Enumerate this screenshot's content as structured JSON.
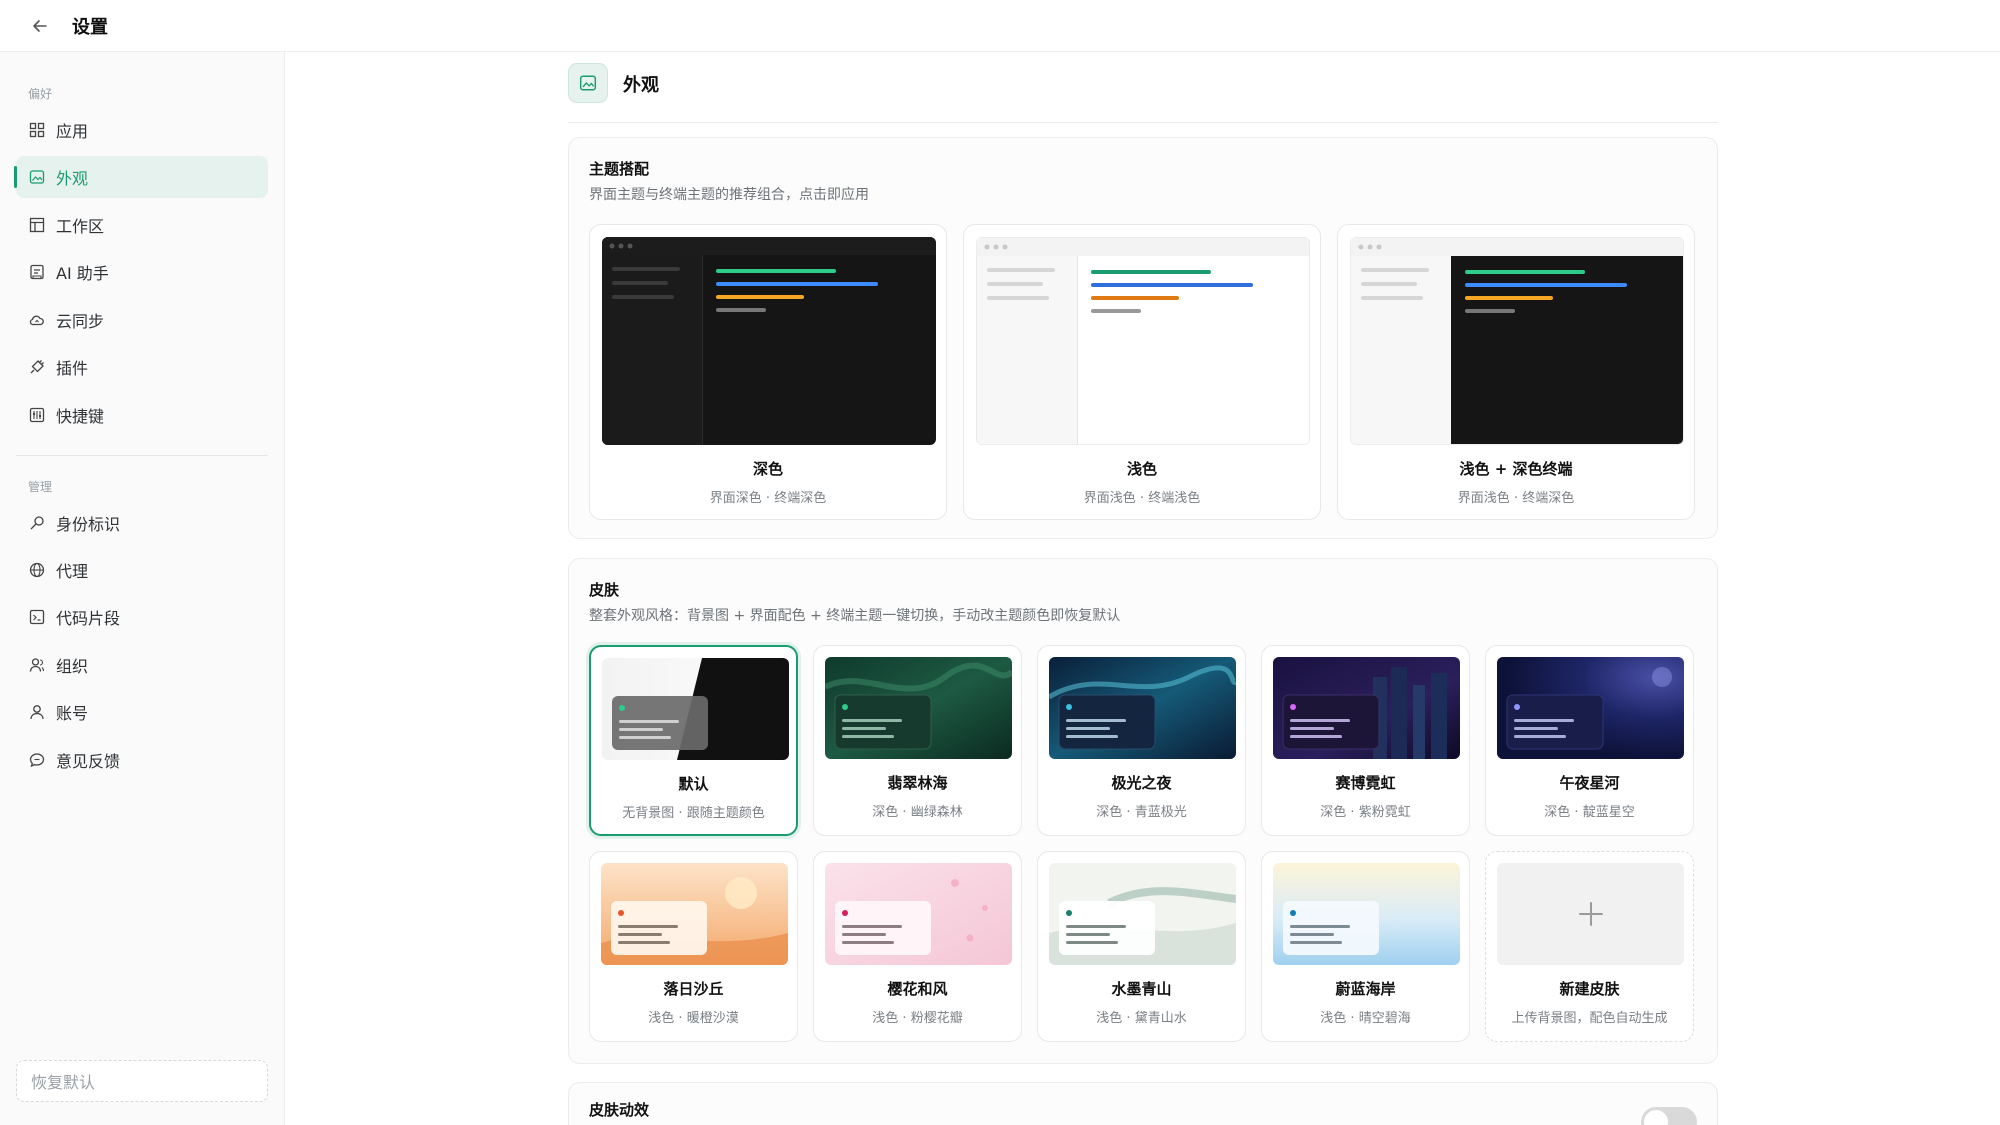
{
  "header": {
    "title": "设置",
    "back_icon": "arrow-left-icon"
  },
  "sidebar": {
    "groups": [
      {
        "label": "偏好"
      },
      {
        "label": "管理"
      }
    ],
    "items": [
      {
        "label": "应用",
        "icon": "grid-icon"
      },
      {
        "label": "外观",
        "icon": "image-icon",
        "active": true
      },
      {
        "label": "工作区",
        "icon": "layout-icon"
      },
      {
        "label": "AI 助手",
        "icon": "ai-icon"
      },
      {
        "label": "云同步",
        "icon": "cloud-sync-icon"
      },
      {
        "label": "插件",
        "icon": "plugin-icon"
      },
      {
        "label": "快捷键",
        "icon": "keyboard-icon"
      },
      {
        "label": "身份标识",
        "icon": "key-icon"
      },
      {
        "label": "代理",
        "icon": "globe-icon"
      },
      {
        "label": "代码片段",
        "icon": "terminal-icon"
      },
      {
        "label": "组织",
        "icon": "team-icon"
      },
      {
        "label": "账号",
        "icon": "user-icon"
      },
      {
        "label": "意见反馈",
        "icon": "feedback-icon"
      }
    ],
    "reset_label": "恢复默认"
  },
  "main": {
    "section_title": "外观",
    "theme_panel": {
      "title": "主题搭配",
      "desc": "界面主题与终端主题的推荐组合，点击即应用",
      "cards": [
        {
          "name": "深色",
          "sub": "界面深色 · 终端深色"
        },
        {
          "name": "浅色",
          "sub": "界面浅色 · 终端浅色"
        },
        {
          "name": "浅色 + 深色终端",
          "sub": "界面浅色 · 终端深色"
        }
      ]
    },
    "skin_panel": {
      "title": "皮肤",
      "desc": "整套外观风格：背景图 + 界面配色 + 终端主题一键切换，手动改主题颜色即恢复默认",
      "cards": [
        {
          "name": "默认",
          "sub": "无背景图 · 跟随主题颜色",
          "selected": true
        },
        {
          "name": "翡翠林海",
          "sub": "深色 · 幽绿森林"
        },
        {
          "name": "极光之夜",
          "sub": "深色 · 青蓝极光"
        },
        {
          "name": "赛博霓虹",
          "sub": "深色 · 紫粉霓虹"
        },
        {
          "name": "午夜星河",
          "sub": "深色 · 靛蓝星空"
        },
        {
          "name": "落日沙丘",
          "sub": "浅色 · 暖橙沙漠"
        },
        {
          "name": "樱花和风",
          "sub": "浅色 · 粉樱花瓣"
        },
        {
          "name": "水墨青山",
          "sub": "浅色 · 黛青山水"
        },
        {
          "name": "蔚蓝海岸",
          "sub": "浅色 · 晴空碧海"
        },
        {
          "name": "新建皮肤",
          "sub": "上传背景图，配色自动生成",
          "icon": "plus-icon"
        }
      ]
    },
    "effects_panel": {
      "title": "皮肤动效",
      "toggle_on": false
    }
  },
  "colors": {
    "accent": "#1a9c73",
    "accent_bg": "#e6f2ed"
  }
}
